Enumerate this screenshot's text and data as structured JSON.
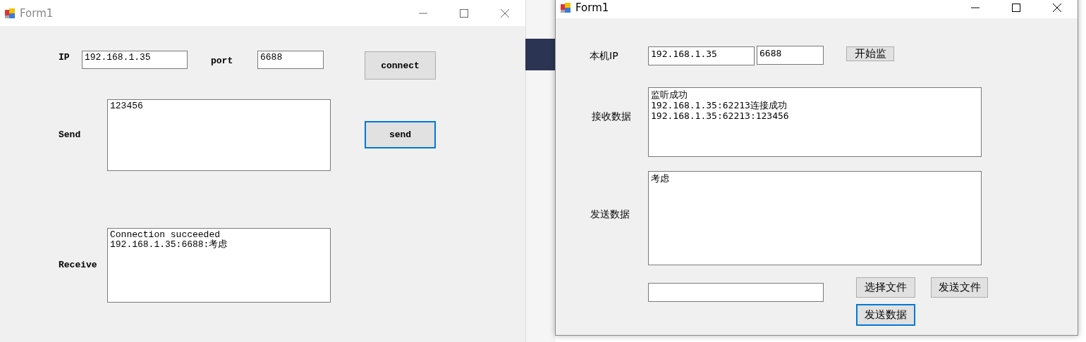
{
  "left_window": {
    "title": "Form1",
    "ip_label": "IP",
    "ip_value": "192.168.1.35",
    "port_label": "port",
    "port_value": "6688",
    "connect_button": {
      "label": "connect",
      "focused": false
    },
    "send_label": "Send",
    "send_text": "123456",
    "send_button": {
      "label": "send",
      "focused": true
    },
    "receive_label": "Receive",
    "receive_lines": [
      "Connection succeeded",
      "192.168.1.35:6688:考虑"
    ]
  },
  "right_window": {
    "title": "Form1",
    "ip_label": "本机IP",
    "ip_value": "192.168.1.35",
    "port_value": "6688",
    "listen_button": {
      "label": "开始监",
      "focused": false
    },
    "receive_label": "接收数据",
    "receive_lines": [
      "监听成功",
      "192.168.1.35:62213连接成功",
      "192.168.1.35:62213:123456"
    ],
    "send_label": "发送数据",
    "send_text": "考虑",
    "choose_file_button": {
      "label": "选择文件",
      "focused": false
    },
    "send_file_button": {
      "label": "发送文件",
      "focused": false
    },
    "send_data_button": {
      "label": "发送数据",
      "focused": true
    }
  }
}
